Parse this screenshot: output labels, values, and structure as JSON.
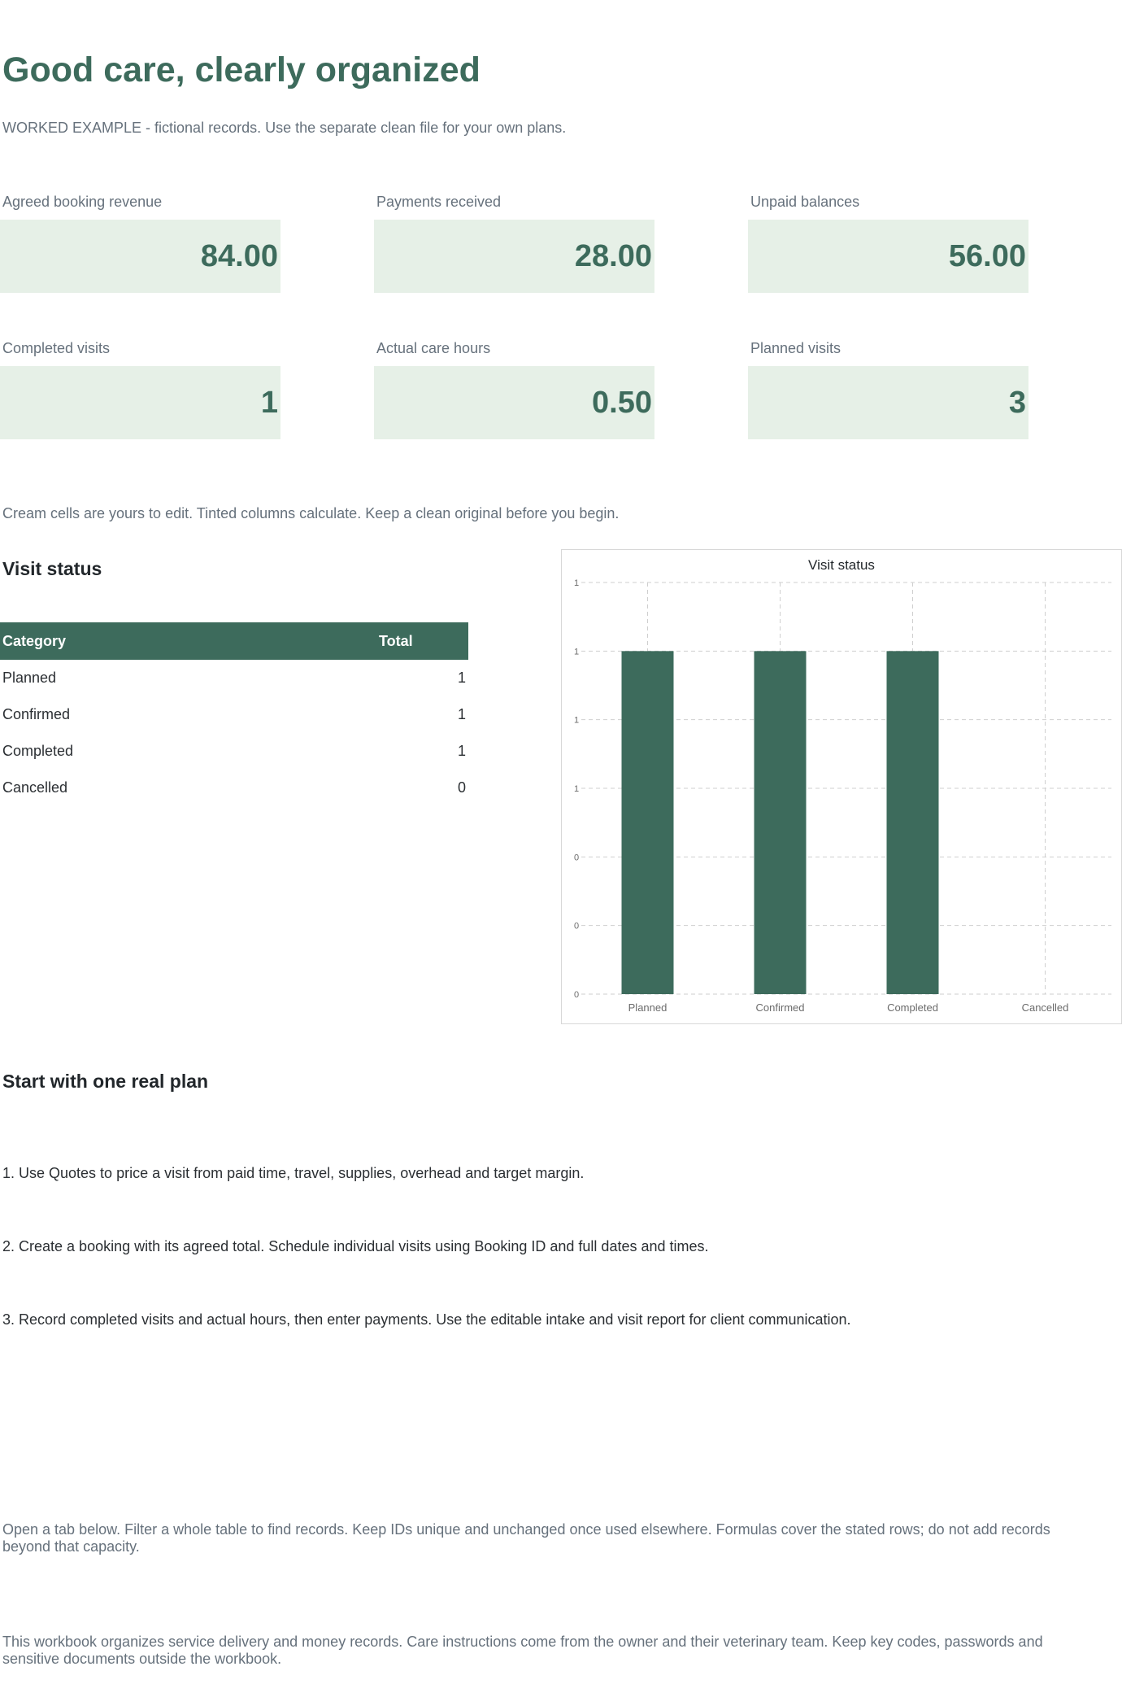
{
  "header": {
    "title": "Good care, clearly organized",
    "subtitle": "WORKED EXAMPLE - fictional records. Use the separate clean file for your own plans."
  },
  "kpis": [
    {
      "label": "Agreed booking revenue",
      "value": "84.00"
    },
    {
      "label": "Payments received",
      "value": "28.00"
    },
    {
      "label": "Unpaid balances",
      "value": "56.00"
    },
    {
      "label": "Completed visits",
      "value": "1"
    },
    {
      "label": "Actual care hours",
      "value": "0.50"
    },
    {
      "label": "Planned visits",
      "value": "3"
    }
  ],
  "note": "Cream cells are yours to edit. Tinted columns calculate. Keep a clean original before you begin.",
  "visit_status": {
    "heading": "Visit status",
    "columns": [
      "Category",
      "Total"
    ],
    "rows": [
      {
        "category": "Planned",
        "total": "1"
      },
      {
        "category": "Confirmed",
        "total": "1"
      },
      {
        "category": "Completed",
        "total": "1"
      },
      {
        "category": "Cancelled",
        "total": "0"
      }
    ]
  },
  "chart_data": {
    "type": "bar",
    "title": "Visit status",
    "categories": [
      "Planned",
      "Confirmed",
      "Completed",
      "Cancelled"
    ],
    "values": [
      1,
      1,
      1,
      0
    ],
    "ytick_labels": [
      "0",
      "0",
      "0",
      "1",
      "1",
      "1",
      "1"
    ],
    "ylim": [
      0,
      1.2
    ],
    "grid": true,
    "legend": "none",
    "bar_color": "#3d6b5c"
  },
  "start": {
    "heading": "Start with one real plan",
    "steps": [
      "1. Use Quotes to price a visit from paid time, travel, supplies, overhead and target margin.",
      "2. Create a booking with its agreed total. Schedule individual visits using Booking ID and full dates and times.",
      "3. Record completed visits and actual hours, then enter payments. Use the editable intake and visit report for client communication."
    ]
  },
  "footer": {
    "tabs_note": "Open a tab below. Filter a whole table to find records. Keep IDs unique and unchanged once used elsewhere. Formulas cover the stated rows; do not add records beyond that capacity.",
    "scope_note": "This workbook organizes service delivery and money records. Care instructions come from the owner and their veterinary team. Keep key codes, passwords and sensitive documents outside the workbook."
  }
}
